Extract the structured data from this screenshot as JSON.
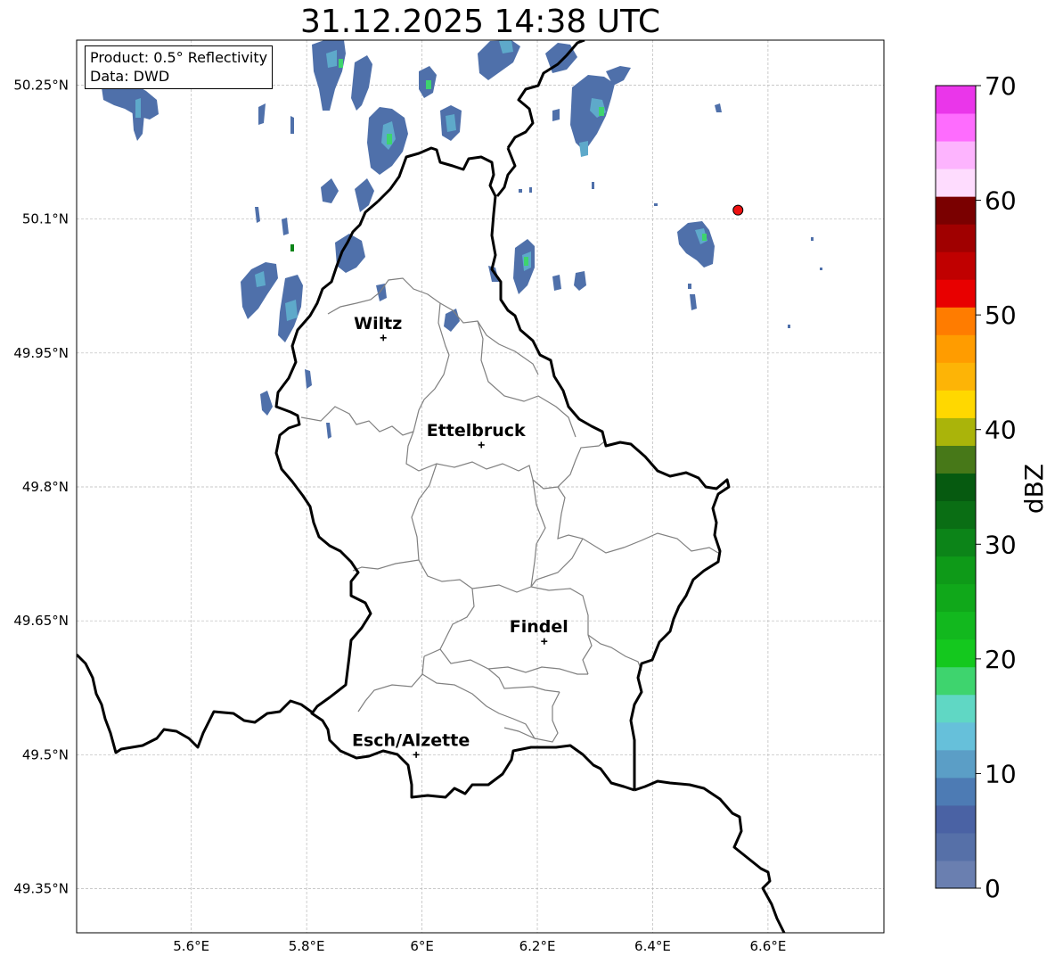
{
  "title": "31.12.2025 14:38 UTC",
  "info": {
    "product": "Product: 0.5° Reflectivity",
    "data": "Data: DWD"
  },
  "map": {
    "lat_ticks": [
      {
        "lat": 50.25,
        "label": "50.25°N"
      },
      {
        "lat": 50.1,
        "label": "50.1°N"
      },
      {
        "lat": 49.95,
        "label": "49.95°N"
      },
      {
        "lat": 49.8,
        "label": "49.8°N"
      },
      {
        "lat": 49.65,
        "label": "49.65°N"
      },
      {
        "lat": 49.5,
        "label": "49.5°N"
      },
      {
        "lat": 49.35,
        "label": "49.35°N"
      }
    ],
    "lon_ticks": [
      {
        "lon": 5.6,
        "label": "5.6°E"
      },
      {
        "lon": 5.8,
        "label": "5.8°E"
      },
      {
        "lon": 6.0,
        "label": "6°E"
      },
      {
        "lon": 6.2,
        "label": "6.2°E"
      },
      {
        "lon": 6.4,
        "label": "6.4°E"
      },
      {
        "lon": 6.6,
        "label": "6.6°E"
      }
    ],
    "cities": [
      {
        "name": "Wiltz",
        "lat": 49.967,
        "lon": 5.933
      },
      {
        "name": "Ettelbruck",
        "lat": 49.847,
        "lon": 6.103
      },
      {
        "name": "Findel",
        "lat": 49.627,
        "lon": 6.212
      },
      {
        "name": "Esch/Alzette",
        "lat": 49.5,
        "lon": 5.99
      }
    ],
    "radar_site": {
      "lat": 50.11,
      "lon": 6.548,
      "color": "#ee1111"
    },
    "border_color": "#000000",
    "canton_color": "#808080"
  },
  "colorbar": {
    "label": "dBZ",
    "tick_labels": [
      "0",
      "10",
      "20",
      "30",
      "40",
      "50",
      "60",
      "70"
    ],
    "colors": [
      "#6a7fb0",
      "#5670a8",
      "#4a62a4",
      "#4d7bb4",
      "#5b9ec6",
      "#66c0da",
      "#60d7c4",
      "#3ed46e",
      "#14c81e",
      "#12b81e",
      "#10a81a",
      "#0e9a18",
      "#0c8418",
      "#0a6e14",
      "#065a10",
      "#477818",
      "#aab40a",
      "#ffd800",
      "#fdb406",
      "#ff9c00",
      "#ff7c00",
      "#e80000",
      "#c00000",
      "#a00000",
      "#7a0000",
      "#fedcfe",
      "#fdb4fe",
      "#fe6cfe",
      "#ea36ea"
    ]
  }
}
